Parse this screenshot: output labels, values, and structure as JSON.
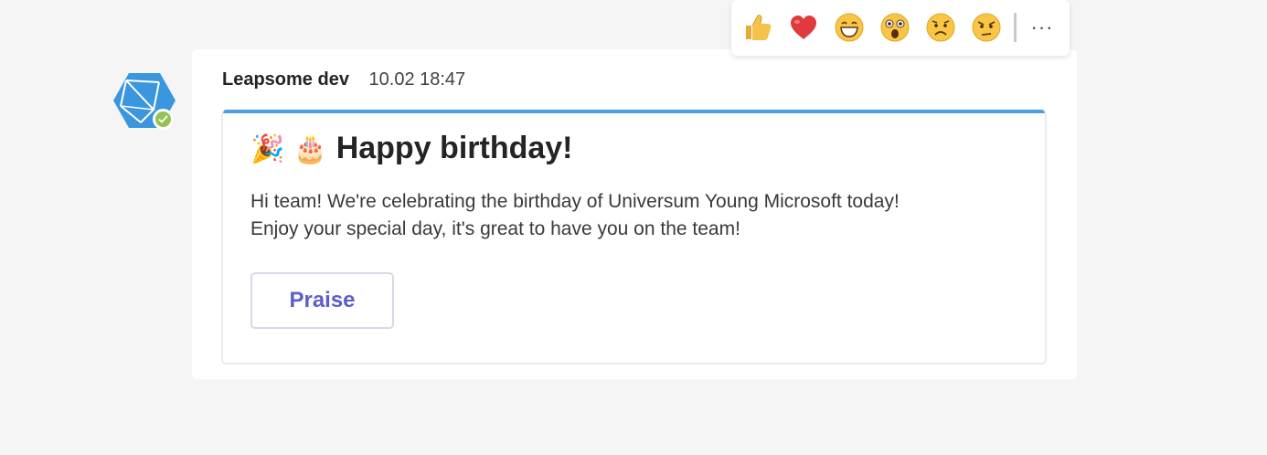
{
  "message": {
    "sender": "Leapsome dev",
    "timestamp": "10.02 18:47",
    "presence": "available"
  },
  "card": {
    "title_emojis": "🎉 🎂",
    "title": "Happy birthday!",
    "body_line1": "Hi team! We're celebrating the birthday of Universum Young Microsoft today!",
    "body_line2": "Enjoy your special day, it's great to have you on the team!",
    "action_label": "Praise"
  },
  "reactions": {
    "items": [
      {
        "name": "like",
        "icon": "thumbs-up-icon"
      },
      {
        "name": "heart",
        "icon": "heart-icon"
      },
      {
        "name": "laugh",
        "icon": "laugh-icon"
      },
      {
        "name": "surprised",
        "icon": "surprised-icon"
      },
      {
        "name": "sad",
        "icon": "sad-icon"
      },
      {
        "name": "angry",
        "icon": "angry-icon"
      }
    ],
    "more_label": "···"
  },
  "colors": {
    "accent": "#4f9fe0",
    "button_text": "#5b5fc7",
    "presence": "#92c353",
    "avatar": "#3a96dd",
    "background": "#f5f5f5"
  }
}
